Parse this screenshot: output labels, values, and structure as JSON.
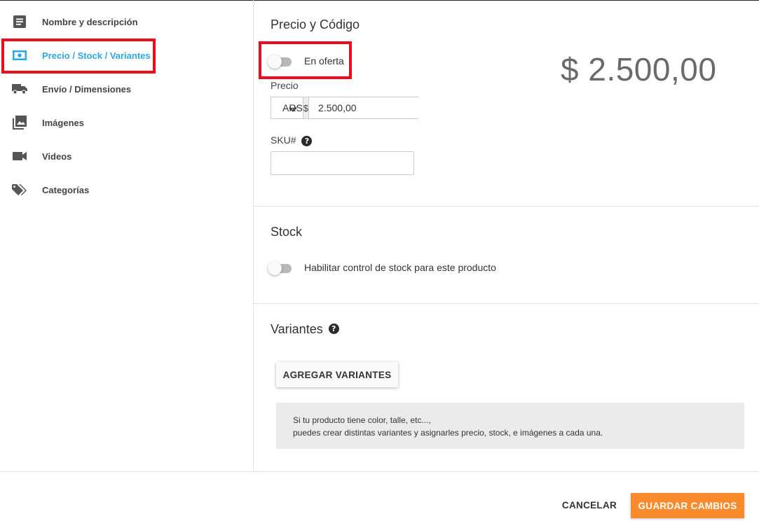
{
  "sidebar": {
    "items": [
      {
        "label": "Nombre y descripción",
        "icon": "article-icon"
      },
      {
        "label": "Precio / Stock / Variantes",
        "icon": "money-icon",
        "active": true
      },
      {
        "label": "Envío / Dimensiones",
        "icon": "truck-icon"
      },
      {
        "label": "Imágenes",
        "icon": "images-icon"
      },
      {
        "label": "Videos",
        "icon": "videocam-icon"
      },
      {
        "label": "Categorías",
        "icon": "tags-icon"
      }
    ]
  },
  "price_section": {
    "title": "Precio y Código",
    "on_sale_label": "En oferta",
    "on_sale_enabled": false,
    "price_label": "Precio",
    "currency": "ARS",
    "currency_symbol": "$",
    "price_value": "2.500,00",
    "sku_label": "SKU#",
    "sku_value": "",
    "display_price": "$ 2.500,00"
  },
  "stock_section": {
    "title": "Stock",
    "toggle_label": "Habilitar control de stock para este producto",
    "enabled": false
  },
  "variants_section": {
    "title": "Variantes",
    "add_button": "AGREGAR VARIANTES",
    "info_line1": "Si tu producto tiene color, talle, etc...,",
    "info_line2": "puedes crear distintas variantes y asignarles precio, stock, e imágenes a cada una."
  },
  "footer": {
    "cancel": "CANCELAR",
    "save": "GUARDAR CAMBIOS"
  },
  "colors": {
    "accent_blue": "#2ea8e0",
    "save_orange": "#f98b2c",
    "highlight_red": "#ee0c1a"
  }
}
